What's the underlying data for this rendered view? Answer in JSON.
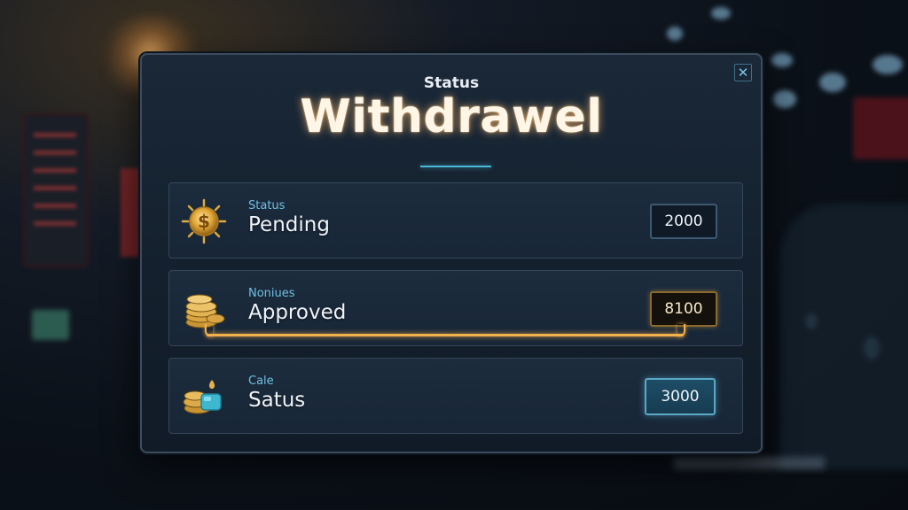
{
  "dialog": {
    "subtitle": "Status",
    "title": "Withdrawel",
    "close_glyph": "✕",
    "accent_color": "#4bb8d8"
  },
  "rows": [
    {
      "label": "Status",
      "value": "Pending",
      "amount": "2000",
      "icon": "gold-coin-dollar-icon"
    },
    {
      "label": "Noniues",
      "value": "Approved",
      "amount": "8100",
      "icon": "coin-stack-icon",
      "progress": 1.0,
      "progress_color": "#f3b04c"
    },
    {
      "label": "Cale",
      "value": "Satus",
      "amount": "3000",
      "icon": "coins-with-gem-icon"
    }
  ]
}
